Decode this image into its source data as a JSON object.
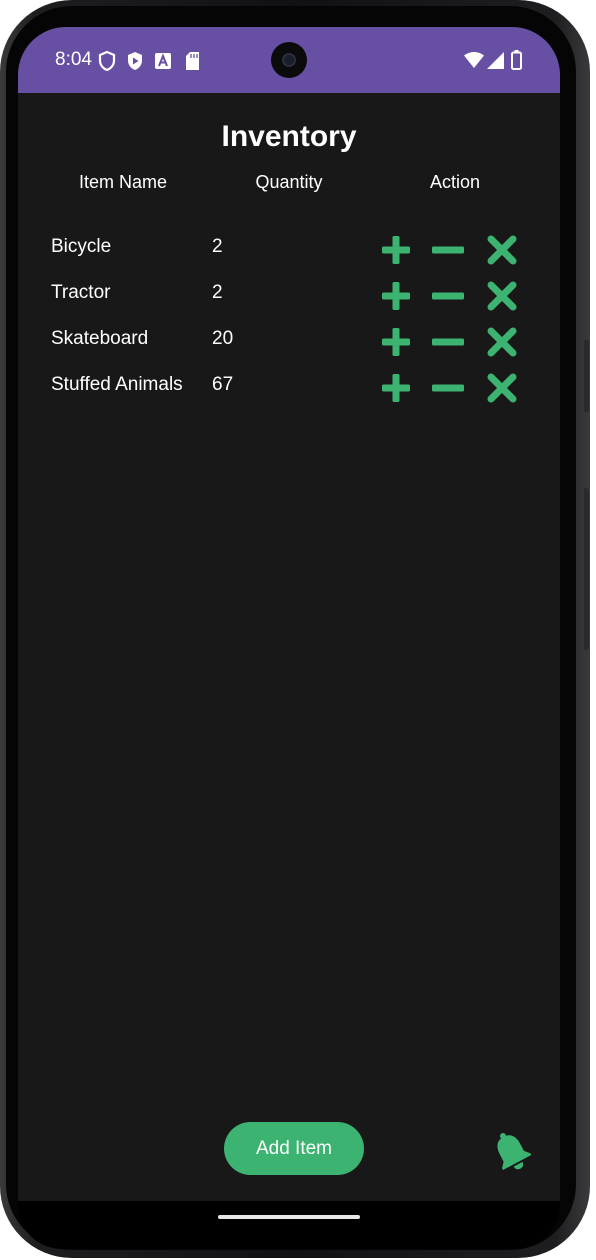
{
  "status_bar": {
    "time": "8:04",
    "left_icons": [
      "shield-icon",
      "play-shield-icon",
      "font-a-icon",
      "sd-card-icon"
    ],
    "right_icons": [
      "wifi-icon",
      "cell-signal-icon",
      "battery-icon"
    ],
    "background": "#6750a4"
  },
  "app": {
    "title": "Inventory",
    "columns": {
      "name": "Item Name",
      "quantity": "Quantity",
      "action": "Action"
    },
    "rows": [
      {
        "name": "Bicycle",
        "quantity": "2"
      },
      {
        "name": "Tractor",
        "quantity": "2"
      },
      {
        "name": "Skateboard",
        "quantity": "20"
      },
      {
        "name": "Stuffed Animals",
        "quantity": "67"
      }
    ],
    "action_icons": [
      "plus-icon",
      "minus-icon",
      "close-icon"
    ],
    "add_button_label": "Add Item",
    "notification_icon": "bell-icon",
    "accent_color": "#3cb371",
    "background": "#181818"
  }
}
